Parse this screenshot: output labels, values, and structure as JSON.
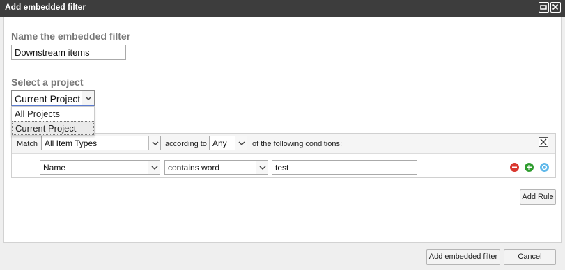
{
  "dialog": {
    "title": "Add embedded filter"
  },
  "name_section": {
    "label": "Name the embedded filter",
    "value": "Downstream items"
  },
  "project_section": {
    "label": "Select a project",
    "selected": "Current Project",
    "options": [
      "All Projects",
      "Current Project"
    ]
  },
  "filter": {
    "match_label": "Match",
    "item_type": "All Item Types",
    "according_to_label": "according to",
    "any_value": "Any",
    "conditions_label": "of the following conditions:",
    "rule": {
      "field": "Name",
      "operator": "contains word",
      "value": "test"
    }
  },
  "buttons": {
    "add_rule": "Add Rule",
    "add_filter": "Add embedded filter",
    "cancel": "Cancel"
  },
  "colors": {
    "titlebar": "#3d3d3d",
    "remove_rule": "#d9372f",
    "add_rule": "#2e9c2e",
    "sync": "#5fb8ea"
  }
}
